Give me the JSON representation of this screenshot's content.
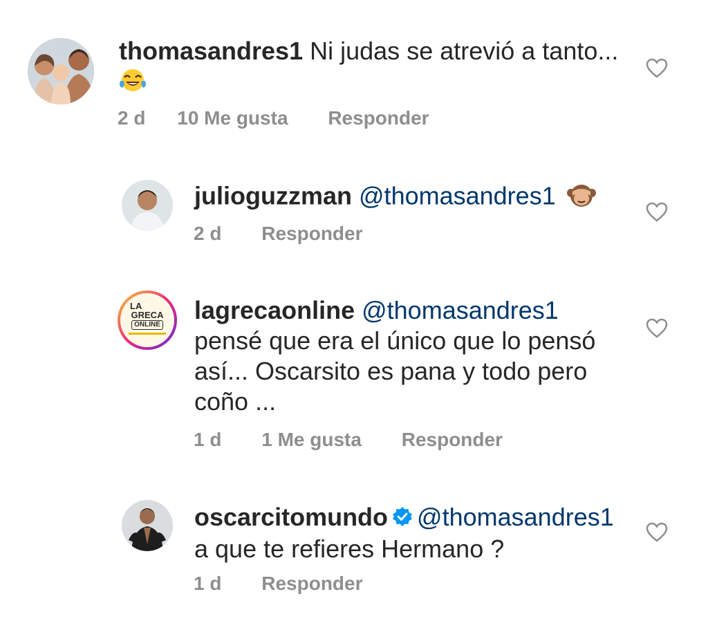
{
  "comments": [
    {
      "username": "thomasandres1",
      "text": "Ni judas se atrevió a tanto...",
      "emoji": "face-with-tears-of-joy",
      "time": "2 d",
      "likes": "10 Me gusta",
      "reply": "Responder"
    },
    {
      "username": "julioguzzman",
      "mention": "@thomasandres1",
      "emoji": "see-no-evil-monkey",
      "time": "2 d",
      "reply": "Responder"
    },
    {
      "username": "lagrecaonline",
      "mention": "@thomasandres1",
      "lines": [
        "pensé que era el único que lo pensó",
        "así... Oscarsito es pana y todo pero",
        "coño ..."
      ],
      "avatar_text": [
        "LA",
        "GRECA",
        "ONLINE"
      ],
      "time": "1 d",
      "likes": "1 Me gusta",
      "reply": "Responder"
    },
    {
      "username": "oscarcitomundo",
      "verified": true,
      "mention": "@thomasandres1",
      "text": "a que te refieres Hermano ?",
      "time": "1 d",
      "reply": "Responder"
    }
  ],
  "colors": {
    "text": "#262626",
    "meta": "#8e8e8e",
    "mention": "#00376b",
    "verified": "#0095f6"
  }
}
